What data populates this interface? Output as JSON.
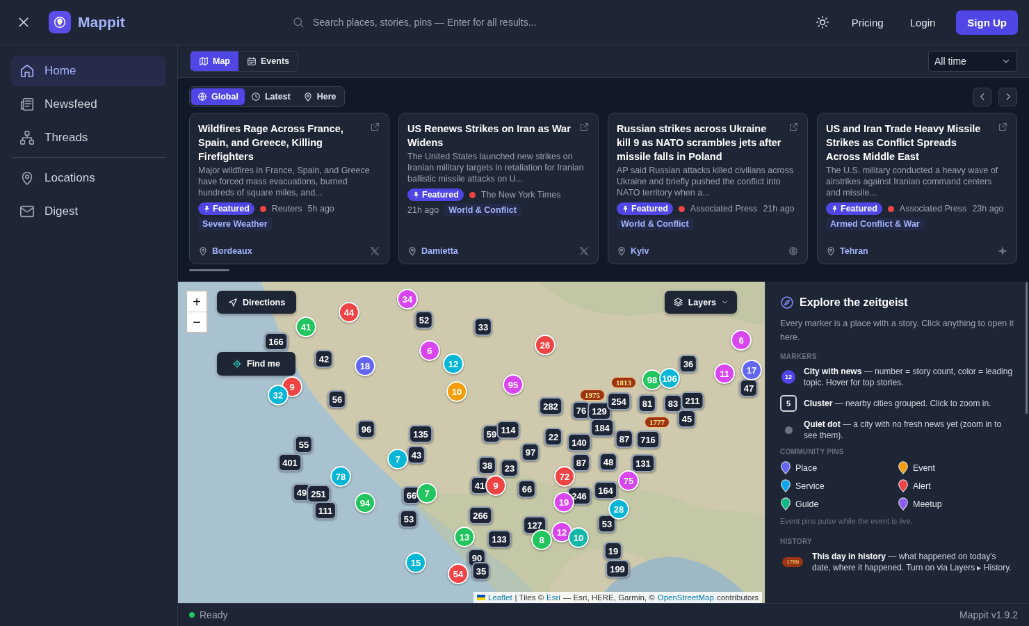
{
  "app": {
    "name": "Mappit"
  },
  "search": {
    "placeholder": "Search places, stories, pins — Enter for all results..."
  },
  "nav_links": [
    "Pricing",
    "Login"
  ],
  "signup": "Sign Up",
  "sidebar": {
    "items": [
      {
        "label": "Home",
        "selected": true
      },
      {
        "label": "Newsfeed",
        "selected": false
      },
      {
        "label": "Threads",
        "selected": false
      },
      {
        "label": "Locations",
        "selected": false
      },
      {
        "label": "Digest",
        "selected": false
      }
    ]
  },
  "view_tabs": [
    {
      "label": "Map",
      "selected": true
    },
    {
      "label": "Events",
      "selected": false
    }
  ],
  "time_filter": {
    "value": "All time"
  },
  "scope_tabs": [
    {
      "label": "Global",
      "selected": true
    },
    {
      "label": "Latest",
      "selected": false
    },
    {
      "label": "Here",
      "selected": false
    }
  ],
  "stories": [
    {
      "title": "Wildfires Rage Across France, Spain, and Greece, Killing Firefighters",
      "summary": "Major wildfires in France, Spain, and Greece have forced mass evacuations, burned hundreds of square miles, and...",
      "badge": "Featured",
      "source": "Reuters",
      "time": "5h ago",
      "topic": "Severe Weather",
      "place": "Bordeaux"
    },
    {
      "title": "US Renews Strikes on Iran as War Widens",
      "summary": "The United States launched new strikes on Iranian military targets in retaliation for Iranian ballistic missile attacks on U...",
      "badge": "Featured",
      "source": "The New York Times",
      "time": "21h ago",
      "topic": "World & Conflict",
      "place": "Damietta"
    },
    {
      "title": "Russian strikes across Ukraine kill 9 as NATO scrambles jets after missile falls in Poland",
      "summary": "AP said Russian attacks killed civilians across Ukraine and briefly pushed the conflict into NATO territory when a...",
      "badge": "Featured",
      "source": "Associated Press",
      "time": "21h ago",
      "topic": "World & Conflict",
      "place": "Kyiv"
    },
    {
      "title": "US and Iran Trade Heavy Missile Strikes as Conflict Spreads Across Middle East",
      "summary": "The U.S. military conducted a heavy wave of airstrikes against Iranian command centers and missile...",
      "badge": "Featured",
      "source": "Associated Press",
      "time": "23h ago",
      "topic": "Armed Conflict & War",
      "place": "Tehran"
    }
  ],
  "map": {
    "zoom_in": "+",
    "zoom_out": "−",
    "directions": "Directions",
    "find_me": "Find me",
    "layers": "Layers",
    "markers": [
      {
        "label": "44",
        "kind": "city",
        "color": "#ef4444"
      },
      {
        "label": "34",
        "kind": "city",
        "color": "#d946ef"
      },
      {
        "label": "52",
        "kind": "cluster"
      },
      {
        "label": "33",
        "kind": "cluster"
      },
      {
        "label": "41",
        "kind": "city",
        "color": "#22c55e"
      },
      {
        "label": "166",
        "kind": "cluster"
      },
      {
        "label": "42",
        "kind": "cluster"
      },
      {
        "label": "18",
        "kind": "city",
        "color": "#6366f1"
      },
      {
        "label": "6",
        "kind": "city",
        "color": "#d946ef"
      },
      {
        "label": "12",
        "kind": "city",
        "color": "#06b6d4"
      },
      {
        "label": "26",
        "kind": "city",
        "color": "#ef4444"
      },
      {
        "label": "9",
        "kind": "city",
        "color": "#ef4444"
      },
      {
        "label": "32",
        "kind": "city",
        "color": "#06b6d4"
      },
      {
        "label": "56",
        "kind": "cluster"
      },
      {
        "label": "10",
        "kind": "city",
        "color": "#f59e0b"
      },
      {
        "label": "95",
        "kind": "city",
        "color": "#d946ef"
      },
      {
        "label": "96",
        "kind": "cluster"
      },
      {
        "label": "135",
        "kind": "cluster"
      },
      {
        "label": "55",
        "kind": "cluster"
      },
      {
        "label": "401",
        "kind": "cluster"
      },
      {
        "label": "7",
        "kind": "city",
        "color": "#06b6d4"
      },
      {
        "label": "43",
        "kind": "cluster"
      },
      {
        "label": "59",
        "kind": "cluster"
      },
      {
        "label": "114",
        "kind": "cluster"
      },
      {
        "label": "282",
        "kind": "cluster"
      },
      {
        "label": "76",
        "kind": "cluster"
      },
      {
        "label": "129",
        "kind": "cluster"
      },
      {
        "label": "254",
        "kind": "cluster"
      },
      {
        "label": "184",
        "kind": "cluster"
      },
      {
        "label": "81",
        "kind": "cluster"
      },
      {
        "label": "83",
        "kind": "cluster"
      },
      {
        "label": "211",
        "kind": "cluster"
      },
      {
        "label": "45",
        "kind": "cluster"
      },
      {
        "label": "98",
        "kind": "city",
        "color": "#22c55e"
      },
      {
        "label": "106",
        "kind": "city",
        "color": "#06b6d4"
      },
      {
        "label": "36",
        "kind": "cluster"
      },
      {
        "label": "6",
        "kind": "city",
        "color": "#d946ef"
      },
      {
        "label": "11",
        "kind": "city",
        "color": "#d946ef"
      },
      {
        "label": "17",
        "kind": "city",
        "color": "#6366f1"
      },
      {
        "label": "47",
        "kind": "cluster"
      },
      {
        "label": "22",
        "kind": "cluster"
      },
      {
        "label": "97",
        "kind": "cluster"
      },
      {
        "label": "140",
        "kind": "cluster"
      },
      {
        "label": "87",
        "kind": "cluster"
      },
      {
        "label": "716",
        "kind": "cluster"
      },
      {
        "label": "87",
        "kind": "cluster"
      },
      {
        "label": "48",
        "kind": "cluster"
      },
      {
        "label": "131",
        "kind": "cluster"
      },
      {
        "label": "78",
        "kind": "city",
        "color": "#06b6d4"
      },
      {
        "label": "38",
        "kind": "cluster"
      },
      {
        "label": "23",
        "kind": "cluster"
      },
      {
        "label": "41",
        "kind": "cluster"
      },
      {
        "label": "9",
        "kind": "city",
        "color": "#ef4444"
      },
      {
        "label": "66",
        "kind": "cluster"
      },
      {
        "label": "72",
        "kind": "city",
        "color": "#ef4444"
      },
      {
        "label": "75",
        "kind": "city",
        "color": "#d946ef"
      },
      {
        "label": "49",
        "kind": "cluster"
      },
      {
        "label": "251",
        "kind": "cluster"
      },
      {
        "label": "111",
        "kind": "cluster"
      },
      {
        "label": "94",
        "kind": "city",
        "color": "#22c55e"
      },
      {
        "label": "66",
        "kind": "cluster"
      },
      {
        "label": "7",
        "kind": "city",
        "color": "#22c55e"
      },
      {
        "label": "19",
        "kind": "city",
        "color": "#d946ef"
      },
      {
        "label": "246",
        "kind": "cluster"
      },
      {
        "label": "164",
        "kind": "cluster"
      },
      {
        "label": "28",
        "kind": "city",
        "color": "#06b6d4"
      },
      {
        "label": "53",
        "kind": "cluster"
      },
      {
        "label": "266",
        "kind": "cluster"
      },
      {
        "label": "127",
        "kind": "cluster"
      },
      {
        "label": "53",
        "kind": "cluster"
      },
      {
        "label": "13",
        "kind": "city",
        "color": "#22c55e"
      },
      {
        "label": "133",
        "kind": "cluster"
      },
      {
        "label": "8",
        "kind": "city",
        "color": "#22c55e"
      },
      {
        "label": "12",
        "kind": "city",
        "color": "#d946ef"
      },
      {
        "label": "10",
        "kind": "city",
        "color": "#14b8a6"
      },
      {
        "label": "90",
        "kind": "cluster"
      },
      {
        "label": "19",
        "kind": "cluster"
      },
      {
        "label": "15",
        "kind": "city",
        "color": "#06b6d4"
      },
      {
        "label": "54",
        "kind": "city",
        "color": "#ef4444"
      },
      {
        "label": "35",
        "kind": "cluster"
      },
      {
        "label": "199",
        "kind": "cluster"
      },
      {
        "label": "1975",
        "kind": "history"
      },
      {
        "label": "1813",
        "kind": "history"
      },
      {
        "label": "1777",
        "kind": "history"
      }
    ],
    "attribution": {
      "link1": "Leaflet",
      "sep": "| Tiles ©",
      "link2": "Esri",
      "mid": "— Esri, HERE, Garmin, ©",
      "link3": "OpenStreetMap",
      "end": "contributors"
    }
  },
  "legend": {
    "title": "Explore the zeitgeist",
    "intro": "Every marker is a place with a story. Click anything to open it here.",
    "markers_heading": "MARKERS",
    "markers": [
      {
        "kind": "city",
        "sample": "12",
        "text": "**City with news** — number = story count, color = leading topic. Hover for top stories."
      },
      {
        "kind": "cluster",
        "sample": "5",
        "text": "**Cluster** — nearby cities grouped. Click to zoom in."
      },
      {
        "kind": "quiet",
        "text": "**Quiet dot** — a city with no fresh news yet (zoom in to see them)."
      }
    ],
    "pins_heading": "COMMUNITY PINS",
    "pins": [
      {
        "label": "Place",
        "color": "#6366f1"
      },
      {
        "label": "Event",
        "color": "#f59e0b"
      },
      {
        "label": "Service",
        "color": "#0ea5e9"
      },
      {
        "label": "Alert",
        "color": "#ef4444"
      },
      {
        "label": "Guide",
        "color": "#10b981"
      },
      {
        "label": "Meetup",
        "color": "#8b5cf6"
      }
    ],
    "pins_note": "Event pins pulse while the event is live.",
    "history_heading": "HISTORY",
    "history": {
      "sample": "1789",
      "text": "**This day in history** — what happened on today's date, where it happened. Turn on via Layers ▸ History."
    }
  },
  "status_bar": {
    "status": "Ready",
    "online": true,
    "version": "Mappit v1.9.2"
  }
}
